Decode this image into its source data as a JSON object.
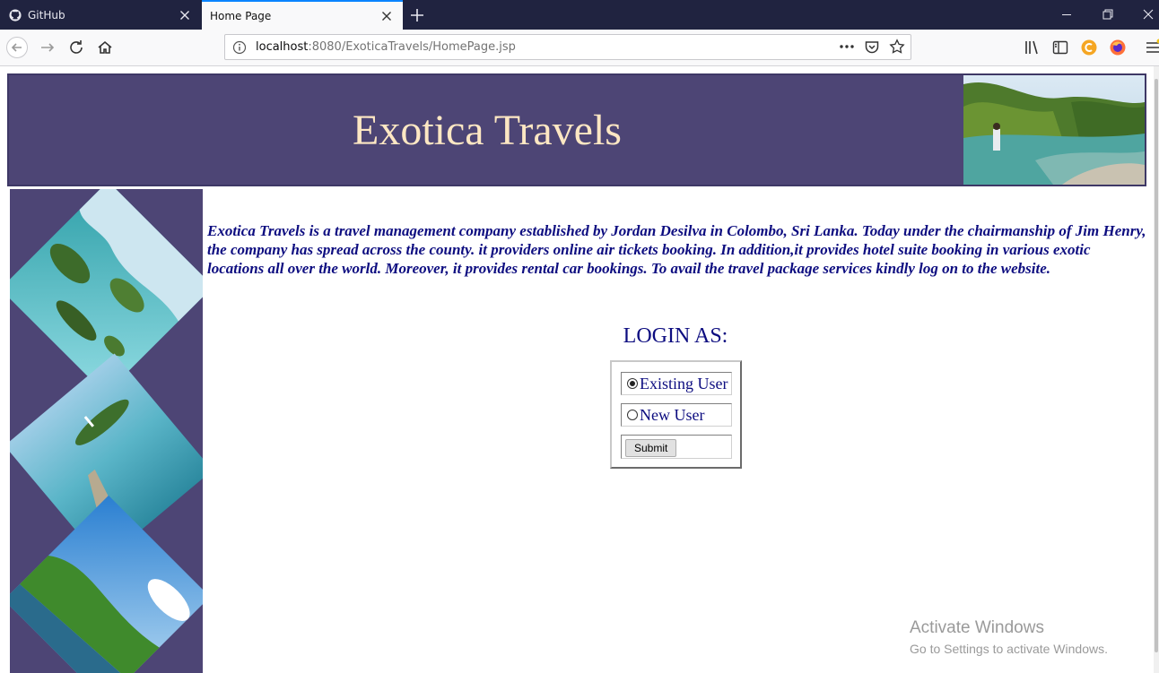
{
  "browser": {
    "tabs": [
      {
        "title": "GitHub",
        "active": false
      },
      {
        "title": "Home Page",
        "active": true
      }
    ],
    "url": {
      "host": "localhost",
      "path": ":8080/ExoticaTravels/HomePage.jsp"
    },
    "accent_color": "#0a84ff"
  },
  "page": {
    "title": "Exotica Travels",
    "intro": "Exotica Travels is a travel management company established by Jordan Desilva in Colombo, Sri Lanka. Today under the chairmanship of Jim Henry, the company has spread across the county. it providers online air tickets booking. In addition,it provides hotel suite booking in various exotic locations all over the world. Moreover, it provides rental car bookings. To avail the travel package services kindly log on to the website.",
    "login": {
      "heading": "LOGIN AS:",
      "options": [
        {
          "label": "Existing User",
          "selected": true
        },
        {
          "label": "New User",
          "selected": false
        }
      ],
      "submit_label": "Submit"
    },
    "colors": {
      "header_bg": "#4d4575",
      "title_color": "#fde7c3",
      "text_color": "#0d0d80"
    }
  },
  "watermark": {
    "line1": "Activate Windows",
    "line2": "Go to Settings to activate Windows."
  }
}
